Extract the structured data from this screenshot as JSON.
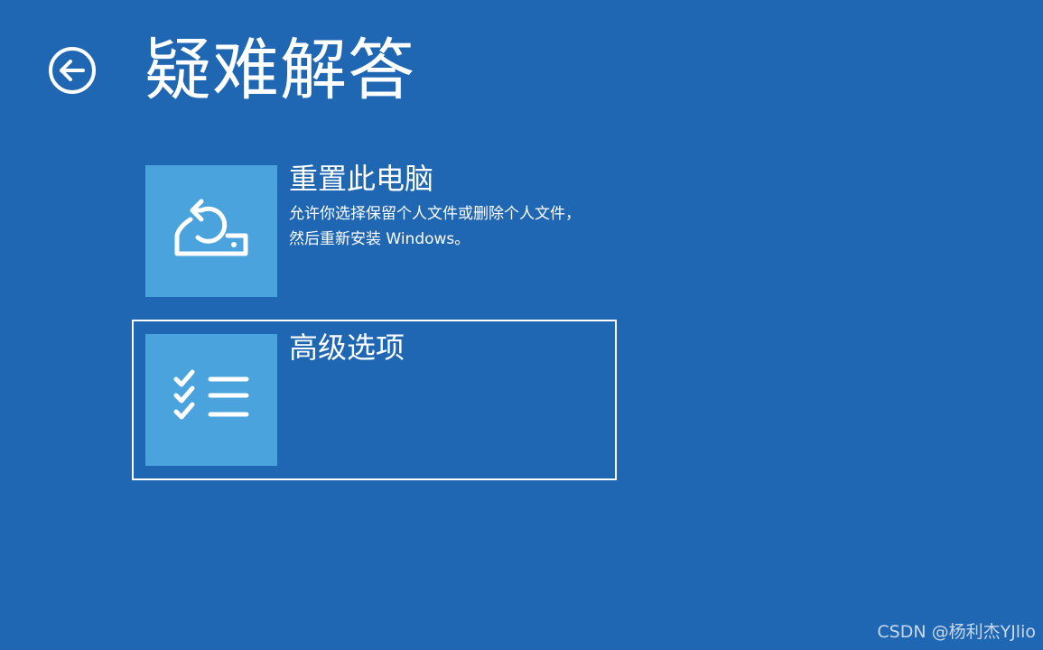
{
  "header": {
    "title": "疑难解答"
  },
  "options": [
    {
      "title": "重置此电脑",
      "description": "允许你选择保留个人文件或删除个人文件，然后重新安装 Windows。",
      "icon": "reset-pc-icon"
    },
    {
      "title": "高级选项",
      "description": "",
      "icon": "checklist-icon"
    }
  ],
  "watermark": "CSDN @杨利杰YJlio",
  "colors": {
    "background": "#1f66b3",
    "tile": "#4aa3dd",
    "text": "#ffffff",
    "focus_border": "#ffffff"
  }
}
